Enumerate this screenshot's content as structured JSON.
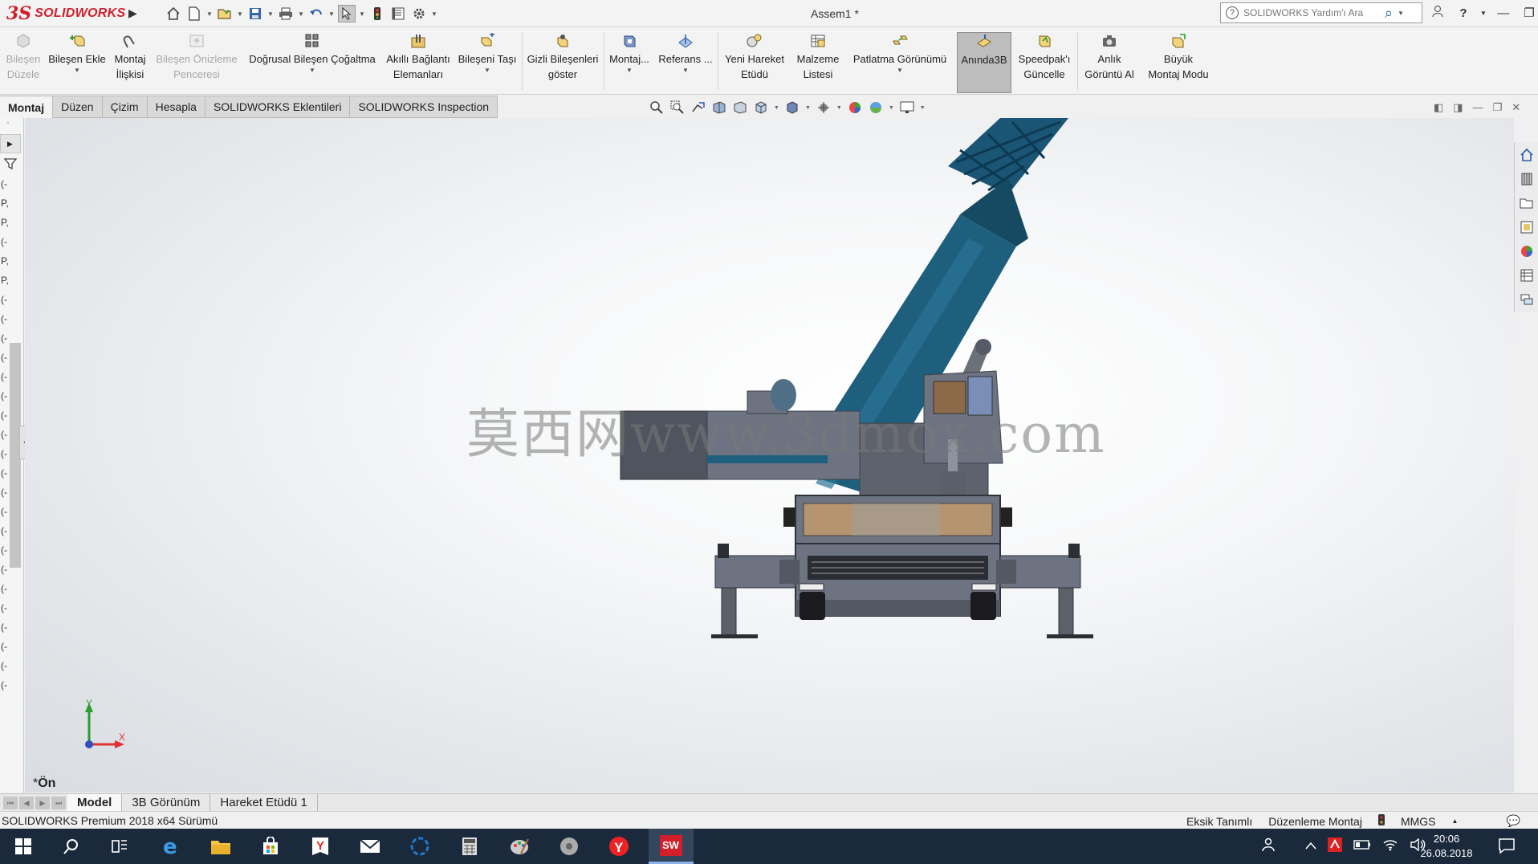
{
  "app": {
    "logo_ds": "3S",
    "logo_brand": "SOLIDWORKS",
    "doc_title": "Assem1 *",
    "help_placeholder": "SOLIDWORKS Yardım'ı Ara"
  },
  "commands": [
    {
      "label1": "Bileşen",
      "label2": "Düzele",
      "disabled": true
    },
    {
      "label1": "Bileşen Ekle",
      "label2": ""
    },
    {
      "label1": "Montaj",
      "label2": "İlişkisi"
    },
    {
      "label1": "Bileşen Önizleme",
      "label2": "Penceresi",
      "disabled": true
    },
    {
      "label1": "Doğrusal Bileşen Çoğaltma",
      "label2": ""
    },
    {
      "label1": "Akıllı Bağlantı",
      "label2": "Elemanları"
    },
    {
      "label1": "Bileşeni Taşı",
      "label2": ""
    },
    {
      "label1": "Gizli Bileşenleri",
      "label2": "göster"
    },
    {
      "label1": "Montaj...",
      "label2": ""
    },
    {
      "label1": "Referans ...",
      "label2": ""
    },
    {
      "label1": "Yeni Hareket",
      "label2": "Etüdü"
    },
    {
      "label1": "Malzeme",
      "label2": "Listesi"
    },
    {
      "label1": "Patlatma Görünümü",
      "label2": ""
    },
    {
      "label1": "Anında3B",
      "label2": "",
      "pressed": true
    },
    {
      "label1": "Speedpak'ı",
      "label2": "Güncelle"
    },
    {
      "label1": "Anlık",
      "label2": "Görüntü Al"
    },
    {
      "label1": "Büyük",
      "label2": "Montaj Modu"
    }
  ],
  "tabs": [
    "Montaj",
    "Düzen",
    "Çizim",
    "Hesapla",
    "SOLIDWORKS Eklentileri",
    "SOLIDWORKS Inspection"
  ],
  "tree_rows": [
    "(-",
    "P,",
    "P,",
    "(-",
    "P,",
    "P,",
    "(-",
    "(-",
    "(-",
    "(-",
    "(-",
    "(-",
    "(-",
    "(-",
    "(-",
    "(-",
    "(-",
    "(-",
    "(-",
    "(-",
    "(-",
    "(-",
    "(-",
    "(-",
    "(-",
    "(-",
    "(-"
  ],
  "viewport": {
    "watermark": "莫西网www.3dmox.com",
    "view_name": "Ön",
    "view_prefix": "*",
    "axis_x": "X",
    "axis_y": "Y"
  },
  "bottom_tabs": [
    "Model",
    "3B Görünüm",
    "Hareket Etüdü 1"
  ],
  "status": {
    "version": "SOLIDWORKS Premium 2018 x64 Sürümü",
    "definition": "Eksik Tanımlı",
    "mode": "Düzenleme Montaj",
    "units": "MMGS"
  },
  "clock": {
    "time": "20:06",
    "date": "26.08.2018"
  },
  "colors": {
    "boom": "#1f5f7e",
    "boom_dark": "#164a63",
    "body": "#6d7380",
    "body_dark": "#535863",
    "brand_red": "#d21f2b",
    "taskbar": "#1a2a3c"
  }
}
